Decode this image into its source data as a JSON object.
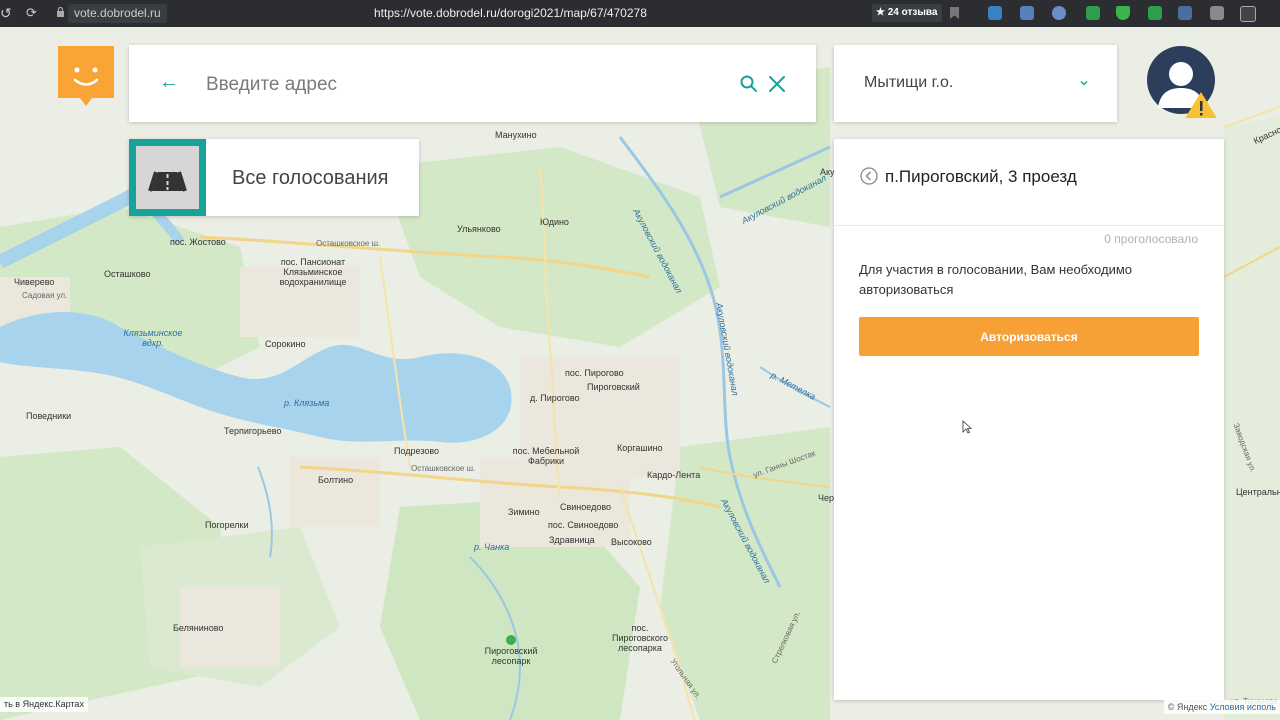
{
  "browser": {
    "domain_chip": "vote.dobrodel.ru",
    "url": "https://vote.dobrodel.ru/dorogi2021/map/67/470278",
    "reviews_badge": "★ 24 отзыва",
    "extension_icons": [
      "mail-icon",
      "mail-icon",
      "cloud-icon",
      "download-icon",
      "shield-icon",
      "download-icon",
      "extension-icon",
      "extension-icon",
      "extension-icon"
    ]
  },
  "search": {
    "placeholder": "Введите адрес",
    "value": ""
  },
  "region": {
    "selected": "Мытищи г.о."
  },
  "all_votes": {
    "label": "Все голосования"
  },
  "panel": {
    "title": "п.Пироговский, 3 проезд",
    "vote_count": "0 проголосовало",
    "message": "Для участия в голосовании, Вам необходимо авторизоваться",
    "auth_button": "Авторизоваться"
  },
  "colors": {
    "accent_teal": "#18a39a",
    "button_orange": "#f7a035",
    "logo_orange": "#f8a535",
    "water": "#a8d3ec",
    "forest": "#cfe6c2"
  },
  "map": {
    "labels": {
      "manukhino": "Манухино",
      "yudino": "Юдино",
      "ulyankovo": "Ульянково",
      "zhostovo": "пос. Жостово",
      "ostashkovskoe": "Осташковское ш.",
      "pansionat1": "пос. Пансионат",
      "pansionat2": "Клязьминское",
      "pansionat3": "водохранилище",
      "chiverevo": "Чиверево",
      "ostashkovo": "Осташково",
      "sadovaya": "Садовая ул.",
      "reservoir1": "Клязьминское",
      "reservoir2": "вдхр.",
      "sorokino": "Сорокино",
      "klyazma": "р. Клязьма",
      "povedniki": "Поведники",
      "terpigorevo": "Терпигорьево",
      "podrezovo": "Подрезово",
      "ostashkovskoe2": "Осташковское ш.",
      "boltino": "Болтино",
      "pogorelki": "Погорелки",
      "belyaninovo": "Беляниново",
      "pos_pirogovo": "пос. Пирогово",
      "pirogovsky": "Пироговский",
      "d_pirogovo": "д. Пирогово",
      "mebelnoy1": "пос. Мебельной",
      "mebelnoy2": "Фабрики",
      "korgashino": "Коргашино",
      "kardo_lenta": "Кардо-Лента",
      "svinoedovo": "Свиноедово",
      "zimino": "Зимино",
      "pos_svinoedovo": "пос. Свиноедово",
      "zdravnitsa": "Здравница",
      "vysokovo": "Высоково",
      "chanka": "р. Чанка",
      "lesopark1": "Пироговский",
      "lesopark2": "лесопарк",
      "pos_lesopark1": "пос.",
      "pos_lesopark2": "Пироговского",
      "pos_lesopark3": "лесопарка",
      "akulovsky": "Акуловский водоканал",
      "metelka": "р. Метелка",
      "gany_shostak": "ул. Ганны Шостак",
      "strelkovaya": "Стрелковая ул.",
      "ugolnaya": "Угольная ул.",
      "tikhonovo": "ул. Тихонова",
      "krasnoe": "Красно",
      "zavodskaya": "Заводская ул.",
      "tsentralnye": "Центральные",
      "chernye": "Чер",
      "akul": "Акул"
    },
    "attribution_left": "ть в Яндекс.Картах",
    "attribution_right": "© Яндекс",
    "terms_link": "Условия исполь"
  }
}
